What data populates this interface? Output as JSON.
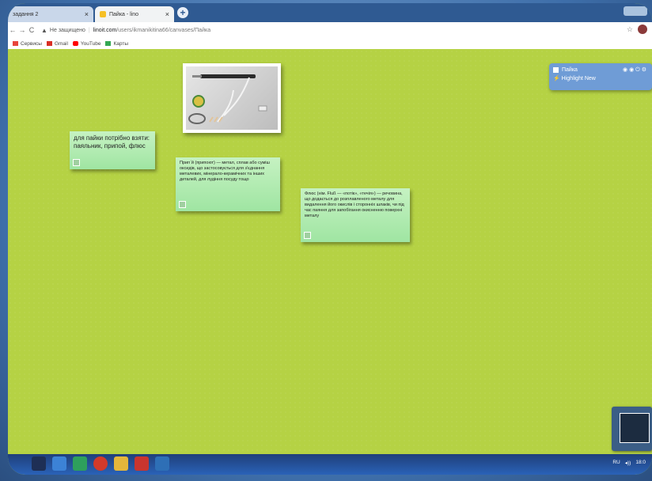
{
  "browser": {
    "tabs": [
      {
        "label": "задання 2",
        "active": false
      },
      {
        "label": "Пайка - lino",
        "active": true
      }
    ],
    "new_tab": "+",
    "toolbar": {
      "back": "←",
      "forward": "→",
      "reload": "C",
      "security": "Не защищено",
      "host": "linoit.com",
      "path": "/users/ikmanikitina66/canvases/Пайка"
    },
    "bookmarks": [
      "Сервисы",
      "Gmail",
      "YouTube",
      "Карты"
    ]
  },
  "canvas": {
    "note1": "для пайки потрібно взяти: паяльник, припой, флюс",
    "note2": "Припˊй (припоют) — метал, сплав або суміш оксидів, що застосовується для з'єднання металевих, мінерало-керамічних та інших деталей, для лудіння посуду тощо",
    "note3": "Флюс (нім. Fluß — «потік», «течія») — речовина, що додається до розплавленого металу для видалення його окислів і сторонніх шлаків, чи під час паяння для запобігання окисненню поверхні металу",
    "panel": {
      "title": "Пайка",
      "highlight": "Highlight New"
    }
  },
  "taskbar": {
    "lang": "RU",
    "time": "18:0"
  },
  "colors": {
    "canvas": "#b5d244",
    "sticky": "#b3ecb4",
    "panel": "#6f9cd6",
    "taskbar": "#2a62b8"
  }
}
